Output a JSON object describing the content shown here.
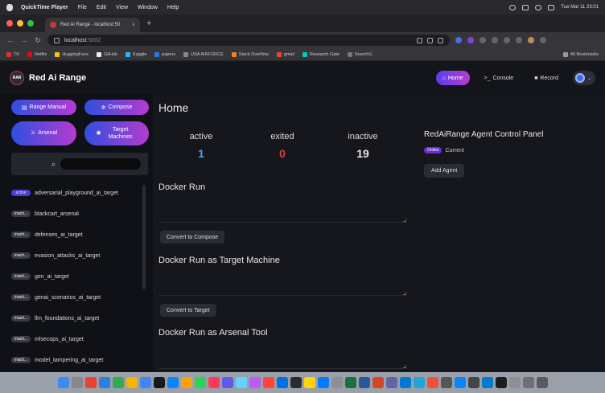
{
  "menubar": {
    "app": "QuickTime Player",
    "items": [
      "File",
      "Edit",
      "View",
      "Window",
      "Help"
    ],
    "status_text": "Tue Mar 11  23:01"
  },
  "browser": {
    "tab_title": "Red Ai Range - localhost:50",
    "tab_close": "×",
    "new_tab": "+",
    "url_host": "localhost",
    "url_port": ":5002",
    "nav": {
      "back": "←",
      "forward": "→",
      "reload": "↻"
    },
    "bookmarks": [
      "TK",
      "Netflix",
      "HuggingFace",
      "GitHub",
      "Kaggle",
      "papers",
      "USA AIRFORCE",
      "Stack Overflow",
      "gmail",
      "Research Gate",
      "SearchG"
    ],
    "all_bookmarks": "All Bookmarks"
  },
  "header": {
    "logo": "RAR",
    "brand": "Red Ai Range",
    "nav": [
      {
        "label": "Home",
        "icon": "⌂"
      },
      {
        "label": "Console",
        "icon": ">_"
      },
      {
        "label": "Record",
        "icon": "■"
      }
    ],
    "user_chevron": "⌄"
  },
  "sidebar": {
    "buttons": {
      "range_manual": "Range Manual",
      "compose": "Compose",
      "arsenal": "Arsenal",
      "target_machines": "Target Machines"
    },
    "search_placeholder": "",
    "search_icon": "⌕",
    "items": [
      {
        "status": "active",
        "name": "adversarial_playground_ai_target"
      },
      {
        "status": "inacti...",
        "name": "blackcart_arsenal"
      },
      {
        "status": "inacti...",
        "name": "defenses_ai_target"
      },
      {
        "status": "inacti...",
        "name": "evasion_attacks_ai_target"
      },
      {
        "status": "inacti...",
        "name": "gen_ai_target"
      },
      {
        "status": "inacti...",
        "name": "genai_scenarios_ai_target"
      },
      {
        "status": "inacti...",
        "name": "llm_foundations_ai_target"
      },
      {
        "status": "inacti...",
        "name": "mlsecops_ai_target"
      },
      {
        "status": "inacti...",
        "name": "model_tampering_ai_target"
      }
    ]
  },
  "main": {
    "title": "Home",
    "stats": [
      {
        "label": "active",
        "value": "1",
        "color": "#4a9cff"
      },
      {
        "label": "exited",
        "value": "0",
        "color": "#e03a3a"
      },
      {
        "label": "inactive",
        "value": "19",
        "color": "#e8e8e8"
      }
    ],
    "agent": {
      "title": "RedAiRange Agent Control Panel",
      "badge": "Online",
      "current_label": "Current",
      "add_button": "Add Agent"
    },
    "sections": [
      {
        "title": "Docker Run",
        "button": "Convert to Compose"
      },
      {
        "title": "Docker Run as Target Machine",
        "button": "Convert to Target"
      },
      {
        "title": "Docker Run as Arsenal Tool"
      }
    ]
  },
  "colors": {
    "accent_gradient_start": "#2f4fe0",
    "accent_gradient_end": "#b53bd0",
    "active_badge": "#4b3fcf"
  }
}
